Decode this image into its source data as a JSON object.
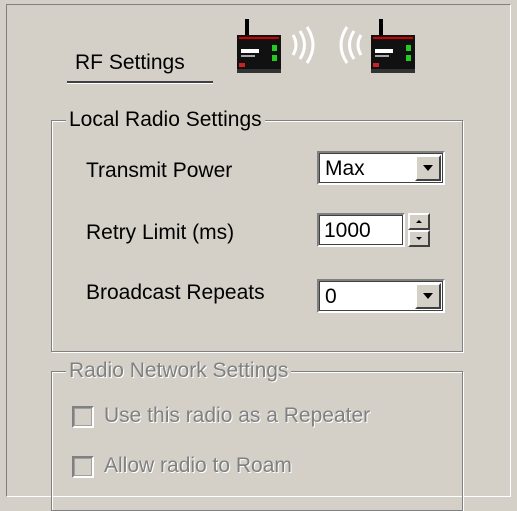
{
  "header": {
    "title": "RF Settings",
    "radio_icon_left": "radio-transmitter-icon",
    "radio_icon_right": "radio-receiver-icon",
    "waves_icon": "radio-waves-icon"
  },
  "local_radio": {
    "legend": "Local Radio Settings",
    "transmit_power": {
      "label": "Transmit Power",
      "value": "Max"
    },
    "retry_limit": {
      "label": "Retry Limit (ms)",
      "value": "1000"
    },
    "broadcast_repeats": {
      "label": "Broadcast Repeats",
      "value": "0"
    }
  },
  "radio_network": {
    "legend": "Radio Network Settings",
    "repeater": {
      "label": "Use this radio as a Repeater",
      "checked": false,
      "enabled": false
    },
    "roam": {
      "label": "Allow radio to Roam",
      "checked": false,
      "enabled": false
    }
  },
  "colors": {
    "background": "#d4d0c8",
    "disabled_text": "#808080",
    "device_led_green": "#22cc22",
    "device_led_red": "#cc2222"
  }
}
